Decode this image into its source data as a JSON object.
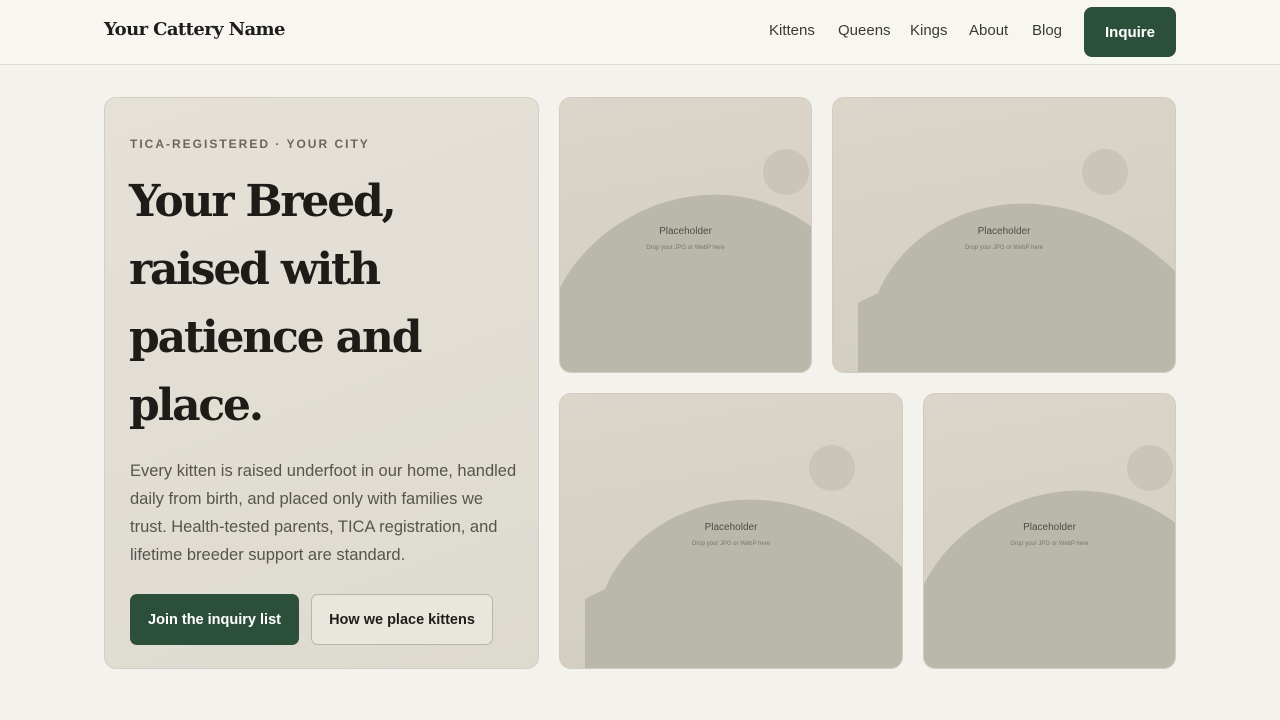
{
  "header": {
    "brand": "Your Cattery Name",
    "nav": [
      "Kittens",
      "Queens",
      "Kings",
      "About",
      "Blog"
    ],
    "cta": "Inquire"
  },
  "hero": {
    "eyebrow": "TICA-REGISTERED · YOUR CITY",
    "headline_lines": [
      "Your Breed,",
      "raised with",
      "patience and",
      "place."
    ],
    "lede": "Every kitten is raised underfoot in our home, handled daily from birth, and placed only with families we trust. Health-tested parents, TICA registration, and lifetime breeder support are standard.",
    "primary_cta": "Join the inquiry list",
    "secondary_cta": "How we place kittens"
  },
  "gallery": {
    "tiles": [
      {
        "label": "Placeholder",
        "sublabel": "Drop your JPG or WebP here"
      },
      {
        "label": "Placeholder",
        "sublabel": "Drop your JPG or WebP here"
      },
      {
        "label": "Placeholder",
        "sublabel": "Drop your JPG or WebP here"
      },
      {
        "label": "Placeholder",
        "sublabel": "Drop your JPG or WebP here"
      }
    ]
  },
  "colors": {
    "accent": "#2c4f3b",
    "background": "#f4f2ec",
    "card": "#e3dfd6",
    "placeholder_shape": "#b9b8a9"
  }
}
